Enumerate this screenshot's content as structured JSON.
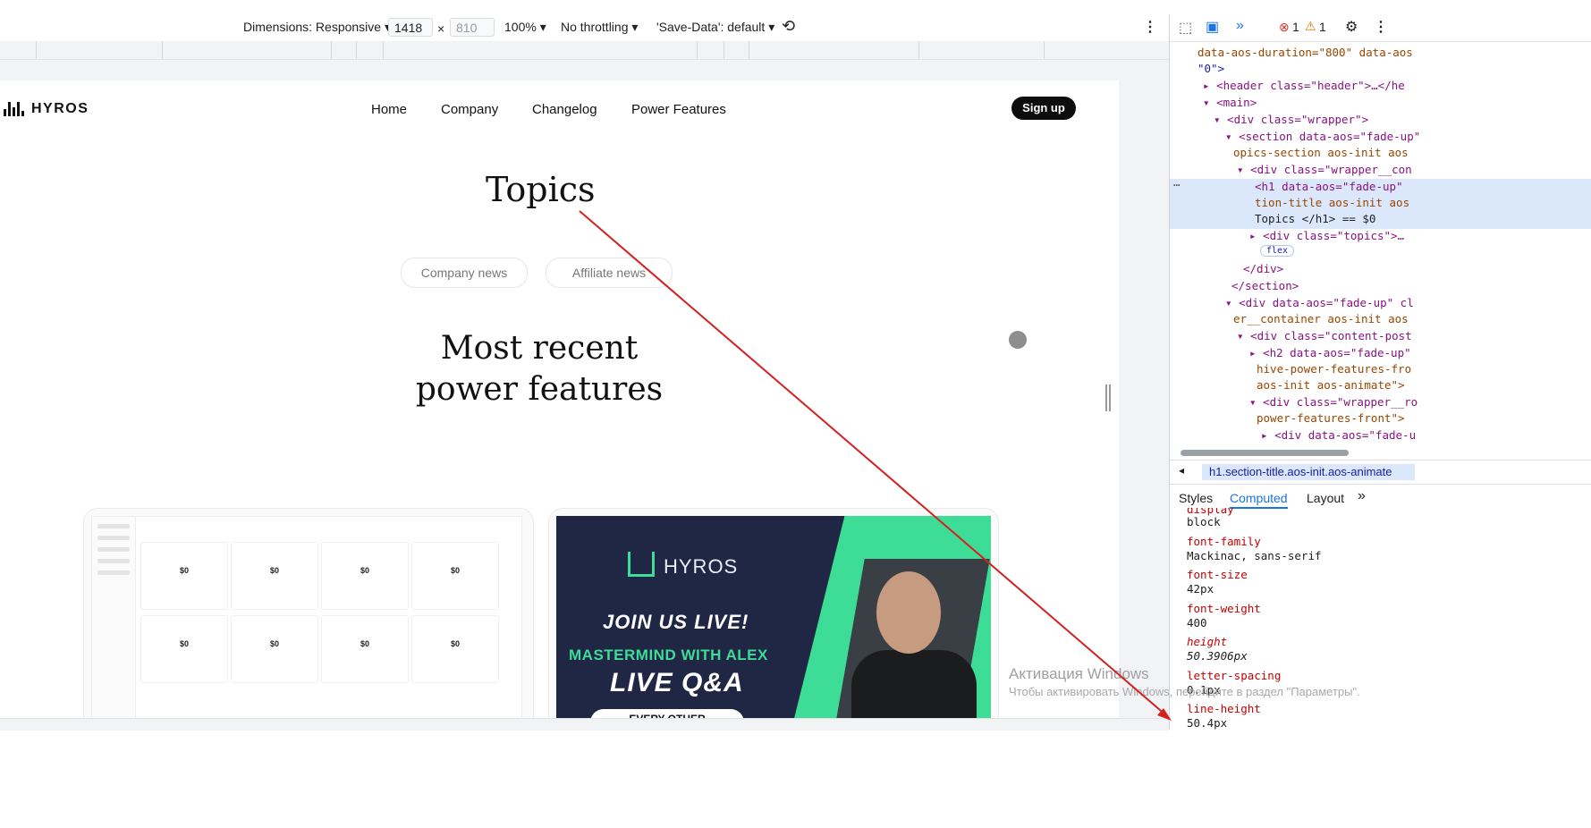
{
  "toolbar": {
    "dimensions": "Dimensions: Responsive",
    "width": "1418",
    "times": "×",
    "height": "810",
    "zoom": "100%",
    "throttle": "No throttling",
    "save_data": "'Save-Data': default"
  },
  "site": {
    "logo": "HYROS",
    "nav": [
      "Home",
      "Company",
      "Changelog",
      "Power Features"
    ],
    "signup": "Sign up",
    "title": "Topics",
    "topics": [
      "Company news",
      "Affiliate news"
    ],
    "section_title": "Most recent power features"
  },
  "dashboard_card": {
    "tiles": [
      "$0",
      "$0",
      "$0",
      "$0",
      "$0",
      "$0",
      "$0",
      "$0"
    ]
  },
  "promo_card": {
    "brand": "HYROS",
    "line1": "JOIN US LIVE!",
    "line2": "MASTERMIND WITH ALEX",
    "line3": "LIVE Q&A",
    "line4": "EVERY OTHER"
  },
  "watermark": {
    "line1": "Активация Windows",
    "line2": "Чтобы активировать Windows, перейдите в раздел \"Параметры\"."
  },
  "devtools": {
    "errors": "1",
    "warnings": "1",
    "elements": [
      "data-aos-duration=\"800\" data-aos",
      "\"0\">",
      "<header class=\"header\">…</he",
      "<main>",
      "<div class=\"wrapper\">",
      "<section data-aos=\"fade-up\"",
      "opics-section aos-init aos",
      "<div class=\"wrapper__con",
      "<h1 data-aos=\"fade-up\"",
      "tion-title aos-init aos",
      "Topics </h1> == $0",
      "<div class=\"topics\">…",
      "flex",
      "</div>",
      "</section>",
      "<div data-aos=\"fade-up\" cl",
      "er__container aos-init aos",
      "<div class=\"content-post",
      "<h2 data-aos=\"fade-up\"",
      "hive-power-features-fro",
      "aos-init aos-animate\">",
      "<div class=\"wrapper__ro",
      "power-features-front\">",
      "<div data-aos=\"fade-u"
    ],
    "breadcrumb": "h1.section-title.aos-init.aos-animate",
    "tabs": [
      "Styles",
      "Computed",
      "Layout"
    ],
    "computed": [
      {
        "prop": "display",
        "value": "block"
      },
      {
        "prop": "font-family",
        "value": "Mackinac, sans-serif"
      },
      {
        "prop": "font-size",
        "value": "42px"
      },
      {
        "prop": "font-weight",
        "value": "400"
      },
      {
        "prop": "height",
        "value": "50.3906px"
      },
      {
        "prop": "letter-spacing",
        "value": "0.1px"
      },
      {
        "prop": "line-height",
        "value": "50.4px"
      }
    ]
  }
}
